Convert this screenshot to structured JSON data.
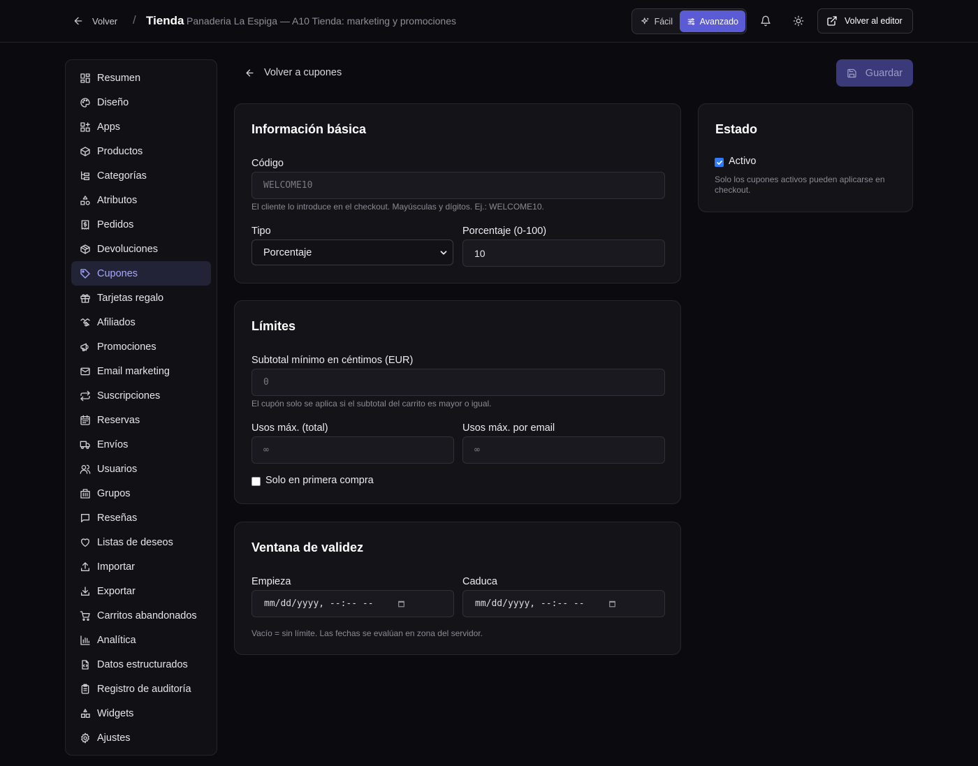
{
  "header": {
    "back_label": "Volver",
    "separator": "/",
    "title": "Tienda",
    "subtitle": "Panaderia La Espiga — A10 Tienda: marketing y promociones",
    "mode_easy": "Fácil",
    "mode_advanced": "Avanzado",
    "editor_label": "Volver al editor"
  },
  "sidebar": {
    "items": [
      {
        "label": "Resumen",
        "icon": "dashboard-icon"
      },
      {
        "label": "Diseño",
        "icon": "palette-icon"
      },
      {
        "label": "Apps",
        "icon": "apps-icon"
      },
      {
        "label": "Productos",
        "icon": "package-icon"
      },
      {
        "label": "Categorías",
        "icon": "tree-icon"
      },
      {
        "label": "Atributos",
        "icon": "shapes-icon"
      },
      {
        "label": "Pedidos",
        "icon": "receipt-icon"
      },
      {
        "label": "Devoluciones",
        "icon": "return-package-icon"
      },
      {
        "label": "Cupones",
        "icon": "tag-icon"
      },
      {
        "label": "Tarjetas regalo",
        "icon": "gift-icon"
      },
      {
        "label": "Afiliados",
        "icon": "handshake-icon"
      },
      {
        "label": "Promociones",
        "icon": "megaphone-icon"
      },
      {
        "label": "Email marketing",
        "icon": "mail-icon"
      },
      {
        "label": "Suscripciones",
        "icon": "repeat-icon"
      },
      {
        "label": "Reservas",
        "icon": "calendar-icon"
      },
      {
        "label": "Envíos",
        "icon": "truck-icon"
      },
      {
        "label": "Usuarios",
        "icon": "users-icon"
      },
      {
        "label": "Grupos",
        "icon": "building-icon"
      },
      {
        "label": "Reseñas",
        "icon": "message-icon"
      },
      {
        "label": "Listas de deseos",
        "icon": "heart-icon"
      },
      {
        "label": "Importar",
        "icon": "upload-icon"
      },
      {
        "label": "Exportar",
        "icon": "download-icon"
      },
      {
        "label": "Carritos abandonados",
        "icon": "cart-icon"
      },
      {
        "label": "Analítica",
        "icon": "bar-chart-icon"
      },
      {
        "label": "Datos estructurados",
        "icon": "file-code-icon"
      },
      {
        "label": "Registro de auditoría",
        "icon": "clipboard-icon"
      },
      {
        "label": "Widgets",
        "icon": "widgets-icon"
      },
      {
        "label": "Ajustes",
        "icon": "gear-icon"
      }
    ],
    "active_index": 8
  },
  "main": {
    "back_label": "Volver a cupones",
    "save_label": "Guardar"
  },
  "basic": {
    "title": "Información básica",
    "code_label": "Código",
    "code_placeholder": "WELCOME10",
    "code_help": "El cliente lo introduce en el checkout. Mayúsculas y dígitos. Ej.: WELCOME10.",
    "type_label": "Tipo",
    "type_value": "Porcentaje",
    "percent_label": "Porcentaje (0-100)",
    "percent_value": "10"
  },
  "limits": {
    "title": "Límites",
    "subtotal_label": "Subtotal mínimo en céntimos (EUR)",
    "subtotal_placeholder": "0",
    "subtotal_help": "El cupón solo se aplica si el subtotal del carrito es mayor o igual.",
    "max_total_label": "Usos máx. (total)",
    "max_total_placeholder": "∞",
    "max_email_label": "Usos máx. por email",
    "max_email_placeholder": "∞",
    "first_purchase_label": "Solo en primera compra",
    "first_purchase_checked": false
  },
  "validity": {
    "title": "Ventana de validez",
    "start_label": "Empieza",
    "start_value": "mm/dd/yyyy, --:-- --",
    "end_label": "Caduca",
    "end_value": "mm/dd/yyyy, --:-- --",
    "help": "Vacío = sin límite. Las fechas se evalúan en zona del servidor."
  },
  "status": {
    "title": "Estado",
    "active_label": "Activo",
    "active_checked": true,
    "help": "Solo los cupones activos pueden aplicarse en checkout."
  },
  "colors": {
    "background": "#0b0b0f",
    "card": "#141418",
    "accent": "#5b5bd6",
    "active_nav_text": "#a5a8ff",
    "checkbox_blue": "#2f7df6"
  }
}
